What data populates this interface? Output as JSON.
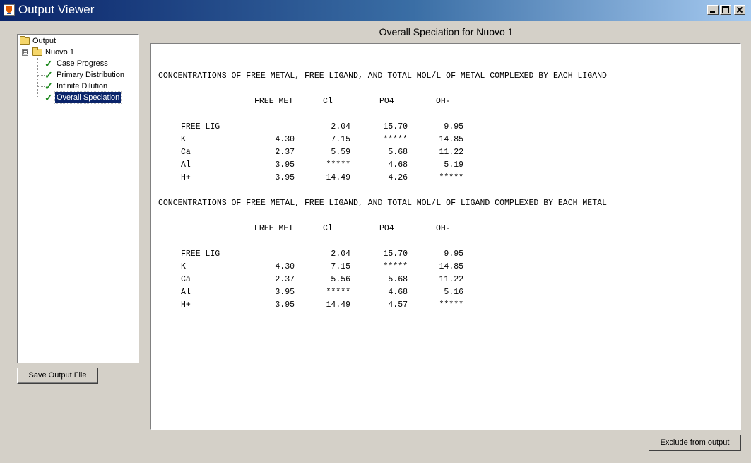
{
  "window": {
    "title": "Output Viewer"
  },
  "tree": {
    "root": {
      "label": "Output",
      "icon": "folder-icon"
    },
    "case": {
      "label": "Nuovo 1",
      "icon": "folder-icon",
      "expander": "⊟"
    },
    "items": [
      {
        "label": "Case Progress",
        "icon": "check-icon",
        "selected": false
      },
      {
        "label": "Primary Distribution",
        "icon": "check-icon",
        "selected": false
      },
      {
        "label": "Infinite Dilution",
        "icon": "check-icon",
        "selected": false
      },
      {
        "label": "Overall Speciation",
        "icon": "check-icon",
        "selected": true
      }
    ]
  },
  "buttons": {
    "save": "Save Output File",
    "exclude": "Exclude from output"
  },
  "panel": {
    "title": "Overall Speciation for Nuovo 1"
  },
  "output": {
    "sections": [
      {
        "heading": "CONCENTRATIONS OF FREE METAL, FREE LIGAND, AND TOTAL MOL/L OF METAL COMPLEXED BY EACH LIGAND",
        "columns": [
          "FREE MET",
          "Cl",
          "PO4",
          "OH-"
        ],
        "rows": [
          {
            "label": "FREE LIG",
            "values": [
              "",
              "2.04",
              "15.70",
              "9.95"
            ]
          },
          {
            "label": "K",
            "values": [
              "4.30",
              "7.15",
              "*****",
              "14.85"
            ]
          },
          {
            "label": "Ca",
            "values": [
              "2.37",
              "5.59",
              "5.68",
              "11.22"
            ]
          },
          {
            "label": "Al",
            "values": [
              "3.95",
              "*****",
              "4.68",
              "5.19"
            ]
          },
          {
            "label": "H+",
            "values": [
              "3.95",
              "14.49",
              "4.26",
              "*****"
            ]
          }
        ]
      },
      {
        "heading": "CONCENTRATIONS OF FREE METAL, FREE LIGAND, AND TOTAL MOL/L OF LIGAND COMPLEXED BY EACH METAL",
        "columns": [
          "FREE MET",
          "Cl",
          "PO4",
          "OH-"
        ],
        "rows": [
          {
            "label": "FREE LIG",
            "values": [
              "",
              "2.04",
              "15.70",
              "9.95"
            ]
          },
          {
            "label": "K",
            "values": [
              "4.30",
              "7.15",
              "*****",
              "14.85"
            ]
          },
          {
            "label": "Ca",
            "values": [
              "2.37",
              "5.56",
              "5.68",
              "11.22"
            ]
          },
          {
            "label": "Al",
            "values": [
              "3.95",
              "*****",
              "4.68",
              "5.16"
            ]
          },
          {
            "label": "H+",
            "values": [
              "3.95",
              "14.49",
              "4.57",
              "*****"
            ]
          }
        ]
      }
    ]
  }
}
